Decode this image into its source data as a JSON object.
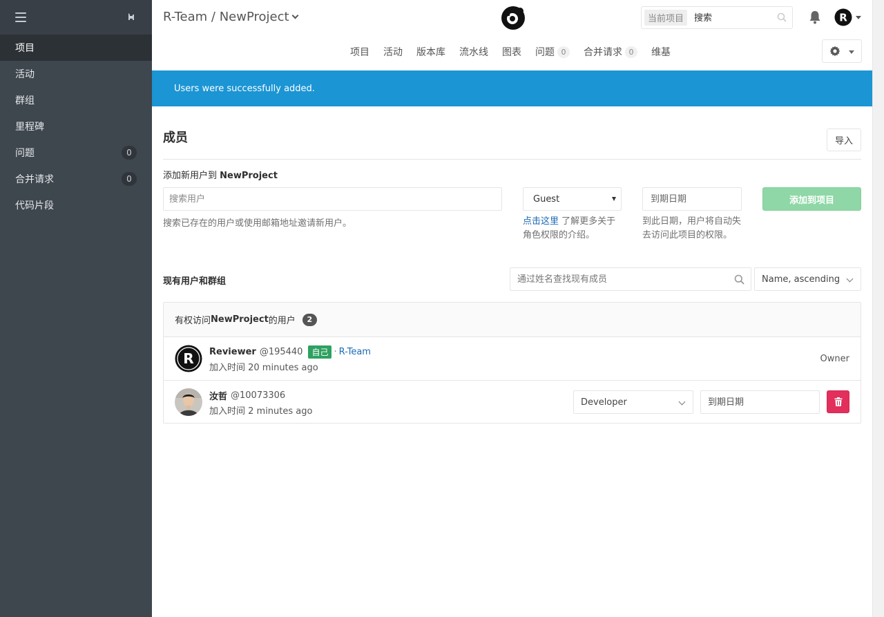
{
  "sidebar": {
    "items": [
      {
        "label": "项目",
        "active": true
      },
      {
        "label": "活动"
      },
      {
        "label": "群组"
      },
      {
        "label": "里程碑"
      },
      {
        "label": "问题",
        "count": "0"
      },
      {
        "label": "合并请求",
        "count": "0"
      },
      {
        "label": "代码片段"
      }
    ]
  },
  "header": {
    "breadcrumb": "R-Team / NewProject",
    "search_scope": "当前项目",
    "search_placeholder": "搜索",
    "avatar_letter": "R"
  },
  "subnav": {
    "items": [
      {
        "label": "项目"
      },
      {
        "label": "活动"
      },
      {
        "label": "版本库"
      },
      {
        "label": "流水线"
      },
      {
        "label": "图表"
      },
      {
        "label": "问题",
        "count": "0"
      },
      {
        "label": "合并请求",
        "count": "0"
      },
      {
        "label": "维基"
      }
    ]
  },
  "flash": "Users were successfully added.",
  "page": {
    "title": "成员",
    "import_label": "导入",
    "add_label_prefix": "添加新用户到 ",
    "add_label_project": "NewProject",
    "user_search_placeholder": "搜索用户",
    "user_search_help": "搜索已存在的用户或使用邮箱地址邀请新用户。",
    "role_value": "Guest",
    "role_help_link": "点击这里",
    "role_help_text": " 了解更多关于角色权限的介绍。",
    "expiry_placeholder": "到期日期",
    "expiry_help": "到此日期，用户将自动失去访问此项目的权限。",
    "add_button": "添加到项目",
    "existing_label": "现有用户和群组",
    "filter_placeholder": "通过姓名查找现有成员",
    "sort_value": "Name, ascending"
  },
  "members": {
    "header_prefix": "有权访问 ",
    "header_project": "NewProject",
    "header_suffix": " 的用户",
    "count": "2",
    "list": [
      {
        "name": "Reviewer",
        "username": "@195440",
        "self_badge": "自己",
        "dot": "·",
        "group": "R-Team",
        "joined": "加入时间 20 minutes ago",
        "role": "Owner"
      },
      {
        "name": "汝哲",
        "username": "@10073306",
        "joined": "加入时间 2 minutes ago",
        "role_select": "Developer",
        "expiry_placeholder": "到期日期"
      }
    ]
  },
  "colors": {
    "sidebar_bg": "#3e464e",
    "flash_bg": "#1b95d4",
    "add_button": "#8fd7a6",
    "self_badge": "#2da160",
    "delete": "#e22f5b",
    "link": "#1b69b6"
  }
}
